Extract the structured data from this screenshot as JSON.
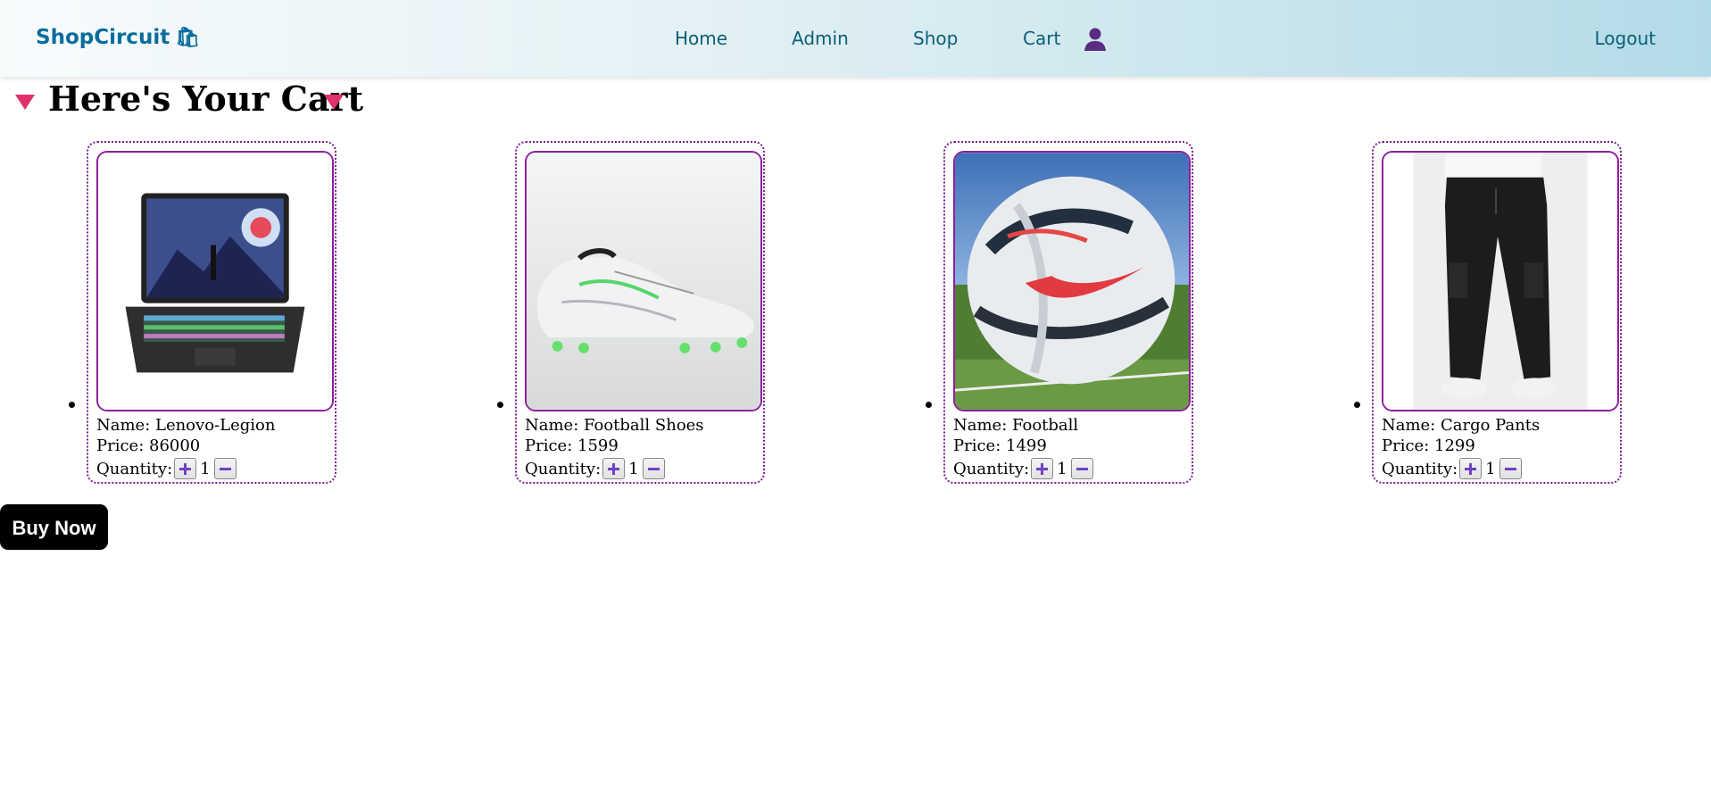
{
  "navbar": {
    "brand": "ShopCircuit",
    "links": [
      "Home",
      "Admin",
      "Shop",
      "Cart"
    ],
    "user_icon": "user-icon",
    "logout": "Logout"
  },
  "heading": "Here's Your Cart",
  "items": [
    {
      "name_text": "Name: Lenovo-Legion",
      "price_text": "Price: 86000",
      "quantity_label": "Quantity:",
      "quantity": "1",
      "image": "laptop"
    },
    {
      "name_text": "Name: Football Shoes",
      "price_text": "Price: 1599",
      "quantity_label": "Quantity:",
      "quantity": "1",
      "image": "football-shoe"
    },
    {
      "name_text": "Name: Football",
      "price_text": "Price: 1499",
      "quantity_label": "Quantity:",
      "quantity": "1",
      "image": "football"
    },
    {
      "name_text": "Name: Cargo Pants",
      "price_text": "Price: 1299",
      "quantity_label": "Quantity:",
      "quantity": "1",
      "image": "cargo-pants"
    }
  ],
  "buy_now": "Buy Now",
  "colors": {
    "brand": "#0a6c9c",
    "nav_link": "#0b5f78",
    "card_border": "#7a1e8f",
    "triangle": "#e0316c",
    "qty_icon": "#6f42c1"
  }
}
